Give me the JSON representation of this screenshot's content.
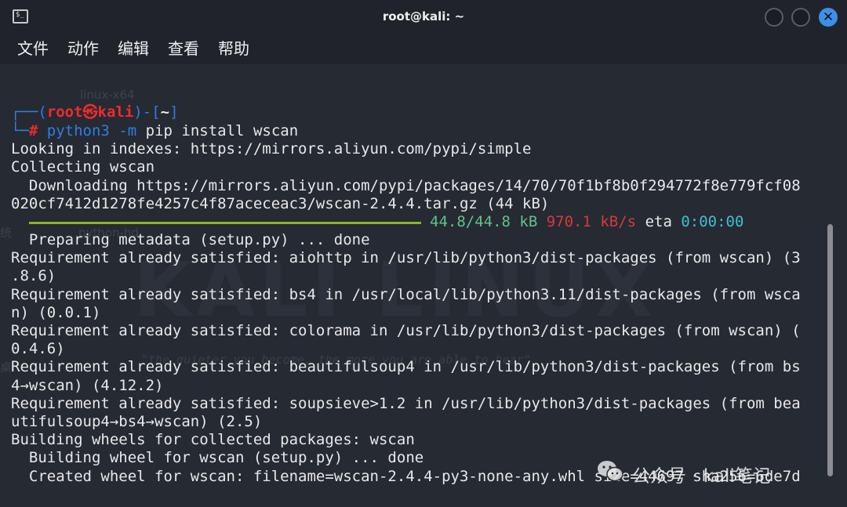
{
  "window": {
    "title": "root@kali: ~",
    "app_icon_glyph": "$_",
    "close_glyph": "✕"
  },
  "menu": {
    "items": [
      "文件",
      "动作",
      "编辑",
      "查看",
      "帮助"
    ]
  },
  "background": {
    "logo_text": "KALI LINUX",
    "tagline": "\"the quieter you become, the more you are able to hear\"",
    "desktop_labels": [
      "linux-x64",
      "统",
      "python-hd",
      "桌"
    ]
  },
  "prompt": {
    "open": "┌──(",
    "user": "root",
    "skull": "㉿",
    "host": "kali",
    "mid": ")-[",
    "dir": "~",
    "close": "]",
    "second": "└─",
    "hash": "#",
    "cmd_python": "python3",
    "cmd_flag": "-m",
    "cmd_rest": "pip install wscan"
  },
  "output": {
    "l1": "Looking in indexes: https://mirrors.aliyun.com/pypi/simple",
    "l2": "Collecting wscan",
    "l3": "  Downloading https://mirrors.aliyun.com/pypi/packages/14/70/70f1bf8b0f294772f8e779fcf08",
    "l4": "020cf7412d1278fe4257c4f87aceceac3/wscan-2.4.4.tar.gz (44 kB)",
    "l6": "  Preparing metadata (setup.py) ... done",
    "l7": "Requirement already satisfied: aiohttp in /usr/lib/python3/dist-packages (from wscan) (3",
    "l8": ".8.6)",
    "l9": "Requirement already satisfied: bs4 in /usr/local/lib/python3.11/dist-packages (from wsca",
    "l10": "n) (0.0.1)",
    "l11": "Requirement already satisfied: colorama in /usr/lib/python3/dist-packages (from wscan) (",
    "l12": "0.4.6)",
    "l13": "Requirement already satisfied: beautifulsoup4 in /usr/lib/python3/dist-packages (from bs",
    "l14": "4→wscan) (4.12.2)",
    "l15": "Requirement already satisfied: soupsieve>1.2 in /usr/lib/python3/dist-packages (from bea",
    "l16": "utifulsoup4→bs4→wscan) (2.5)",
    "l17": "Building wheels for collected packages: wscan",
    "l18": "  Building wheel for wscan (setup.py) ... done",
    "l19": "  Created wheel for wscan: filename=wscan-2.4.4-py3-none-any.whl size=44697 sha256=6de7d"
  },
  "progress": {
    "fraction": 1.0,
    "size": "44.8/44.8 kB",
    "speed": "970.1 kB/s",
    "eta_label": "eta",
    "eta": "0:00:00"
  },
  "watermark": {
    "text": "公众号 · kali笔记"
  },
  "colors": {
    "accent_blue": "#2f7de0",
    "prompt_red": "#ef2b2b",
    "progress_green": "#8ab529",
    "size_green": "#62c08a",
    "speed_red": "#d63a3a",
    "eta_cyan": "#3fbfd0"
  }
}
